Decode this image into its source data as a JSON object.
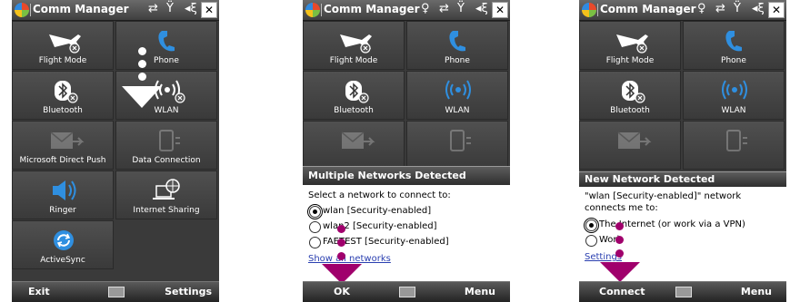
{
  "app_title": "Comm Manager",
  "screen1": {
    "tiles": [
      {
        "label": "Flight Mode",
        "icon": "airplane-icon"
      },
      {
        "label": "Phone",
        "icon": "phone-icon"
      },
      {
        "label": "Bluetooth",
        "icon": "bluetooth-icon"
      },
      {
        "label": "WLAN",
        "icon": "wlan-icon"
      },
      {
        "label": "Microsoft Direct Push",
        "icon": "direct-push-icon"
      },
      {
        "label": "Data Connection",
        "icon": "data-connection-icon"
      },
      {
        "label": "Ringer",
        "icon": "speaker-icon"
      },
      {
        "label": "Internet Sharing",
        "icon": "internet-sharing-icon"
      },
      {
        "label": "ActiveSync",
        "icon": "activesync-icon"
      }
    ],
    "softkeys": {
      "left": "Exit",
      "right": "Settings"
    }
  },
  "screen2": {
    "dialog_title": "Multiple Networks Detected",
    "prompt": "Select a network to connect to:",
    "options": [
      "wlan [Security-enabled]",
      "wlan2 [Security-enabled]",
      "FAETEST [Security-enabled]"
    ],
    "selected_index": 0,
    "link": "Show all networks",
    "softkeys": {
      "left": "OK",
      "right": "Menu"
    }
  },
  "screen3": {
    "dialog_title": "New Network Detected",
    "prompt": "\"wlan [Security-enabled]\" network connects me to:",
    "options": [
      "The Internet (or work via a VPN)",
      "Work"
    ],
    "selected_index": 0,
    "link": "Settings",
    "softkeys": {
      "left": "Connect",
      "right": "Menu"
    }
  },
  "colors": {
    "accent_blue": "#2f8fe0",
    "annotation_magenta": "#a0006c",
    "link_blue": "#2a3fb0"
  }
}
